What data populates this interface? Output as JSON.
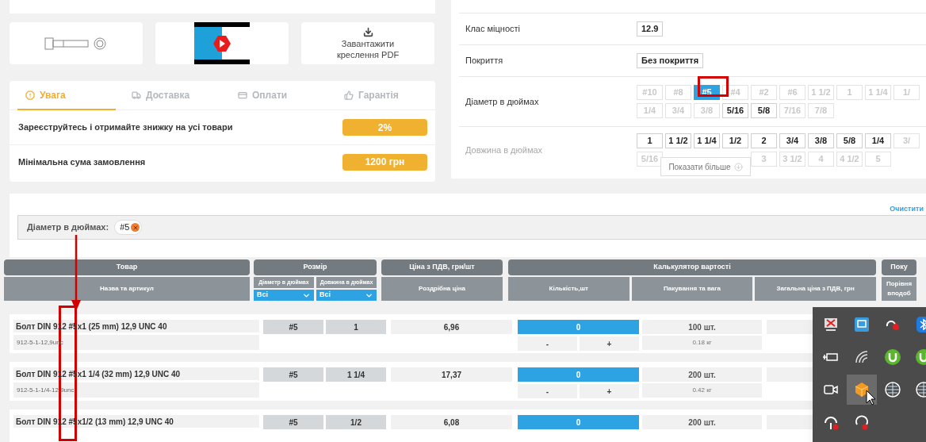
{
  "media": {
    "pdf_label": "Завантажити креслення PDF"
  },
  "tabs": [
    {
      "label": "Увага",
      "selected": true
    },
    {
      "label": "Доставка",
      "selected": false
    },
    {
      "label": "Оплати",
      "selected": false
    },
    {
      "label": "Гарантія",
      "selected": false
    }
  ],
  "promos": [
    {
      "text": "Зареєструйтесь і отримайте знижку на усі товари",
      "value": "2%"
    },
    {
      "text": "Мінімальна сума замовлення",
      "value": "1200 грн"
    }
  ],
  "specs": [
    {
      "label": "Клас міцності",
      "faded": false,
      "rows": [
        [
          {
            "label": "12.9",
            "selected": false,
            "disabled": false
          }
        ]
      ]
    },
    {
      "label": "Покриття",
      "faded": false,
      "rows": [
        [
          {
            "label": "Без покриття",
            "selected": false,
            "disabled": false
          }
        ]
      ]
    },
    {
      "label": "Діаметр в дюймах",
      "faded": false,
      "rows": [
        [
          {
            "label": "#10",
            "selected": false,
            "disabled": true
          },
          {
            "label": "#8",
            "selected": false,
            "disabled": true
          },
          {
            "label": "#5",
            "selected": true,
            "disabled": false
          },
          {
            "label": "#4",
            "selected": false,
            "disabled": true
          },
          {
            "label": "#2",
            "selected": false,
            "disabled": true
          },
          {
            "label": "#6",
            "selected": false,
            "disabled": true
          },
          {
            "label": "1 1/2",
            "selected": false,
            "disabled": true
          },
          {
            "label": "1",
            "selected": false,
            "disabled": true
          },
          {
            "label": "1 1/4",
            "selected": false,
            "disabled": true
          },
          {
            "label": "1/",
            "selected": false,
            "disabled": true
          }
        ],
        [
          {
            "label": "1/4",
            "selected": false,
            "disabled": true
          },
          {
            "label": "3/4",
            "selected": false,
            "disabled": true
          },
          {
            "label": "3/8",
            "selected": false,
            "disabled": true
          },
          {
            "label": "5/16",
            "selected": false,
            "disabled": false
          },
          {
            "label": "5/8",
            "selected": false,
            "disabled": false
          },
          {
            "label": "7/16",
            "selected": false,
            "disabled": true
          },
          {
            "label": "7/8",
            "selected": false,
            "disabled": true
          }
        ]
      ]
    },
    {
      "label": "Довжина в дюймах",
      "faded": true,
      "show_more": "Показати більше",
      "rows": [
        [
          {
            "label": "1",
            "selected": false,
            "disabled": false
          },
          {
            "label": "1 1/2",
            "selected": false,
            "disabled": false
          },
          {
            "label": "1 1/4",
            "selected": false,
            "disabled": false
          },
          {
            "label": "1/2",
            "selected": false,
            "disabled": false
          },
          {
            "label": "2",
            "selected": false,
            "disabled": false
          },
          {
            "label": "3/4",
            "selected": false,
            "disabled": false
          },
          {
            "label": "3/8",
            "selected": false,
            "disabled": false
          },
          {
            "label": "5/8",
            "selected": false,
            "disabled": false
          },
          {
            "label": "1/4",
            "selected": false,
            "disabled": false
          },
          {
            "label": "3/",
            "selected": false,
            "disabled": true
          }
        ],
        [
          {
            "label": "5/16",
            "selected": false,
            "disabled": true
          },
          "",
          "",
          "",
          {
            "label": "3",
            "selected": false,
            "disabled": true
          },
          {
            "label": "3 1/2",
            "selected": false,
            "disabled": true
          },
          {
            "label": "4",
            "selected": false,
            "disabled": true
          },
          {
            "label": "4 1/2",
            "selected": false,
            "disabled": true
          },
          {
            "label": "5",
            "selected": false,
            "disabled": true
          }
        ]
      ]
    }
  ],
  "clear_link": "Очистити",
  "filter": {
    "label": "Діаметр в дюймах:",
    "chips": [
      {
        "label": "#5"
      }
    ]
  },
  "table": {
    "groups": [
      {
        "label": "Товар",
        "columns": [
          {
            "label": "Назва та артикул"
          }
        ]
      },
      {
        "label": "Розмір",
        "columns": [
          {
            "label": "Діаметр в дюймах",
            "select": "Всі"
          },
          {
            "label": "Довжина в дюймах",
            "select": "Всі"
          }
        ]
      },
      {
        "label": "Ціна з ПДВ, грн/шт",
        "columns": [
          {
            "label": "Роздрібна ціна"
          }
        ]
      },
      {
        "label": "Калькулятор вартості",
        "columns": [
          {
            "label": "Кількість,шт"
          },
          {
            "label": "Пакування та вага"
          },
          {
            "label": "Загальна ціна з ПДВ, грн"
          }
        ]
      },
      {
        "label": "Поку",
        "columns": [
          {
            "label": "Порівня вподоб"
          }
        ]
      }
    ],
    "rows": [
      {
        "name": "Болт DIN 912 #5x1 (25 mm) 12,9 UNC 40",
        "article": "912-5-1-12,9unc",
        "diameter": "#5",
        "length": "1",
        "price": "6,96",
        "qty": "0",
        "minus": "-",
        "plus": "+",
        "pack": "100 шт.",
        "weight": "0.18 кг"
      },
      {
        "name": "Болт DIN 912 #5x1 1/4 (32 mm) 12,9 UNC 40",
        "article": "912-5-1-1/4-12,9unc",
        "diameter": "#5",
        "length": "1 1/4",
        "price": "17,37",
        "qty": "0",
        "minus": "-",
        "plus": "+",
        "pack": "200 шт.",
        "weight": "0.42 кг"
      },
      {
        "name": "Болт DIN 912 #5x1/2 (13 mm) 12,9 UNC 40",
        "diameter": "#5",
        "length": "1/2",
        "price": "6,08",
        "qty": "0",
        "pack": "200 шт."
      }
    ]
  }
}
